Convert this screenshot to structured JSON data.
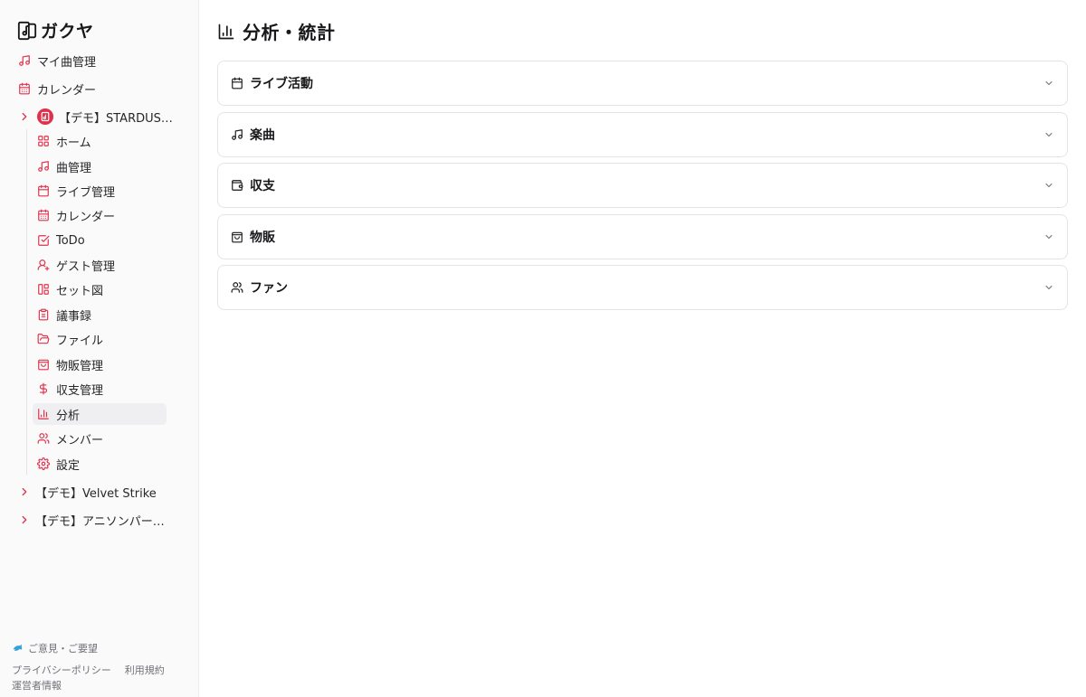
{
  "app": {
    "name": "ガクヤ"
  },
  "sidebar": {
    "top_items": [
      {
        "label": "マイ曲管理",
        "icon": "music-note-icon"
      },
      {
        "label": "カレンダー",
        "icon": "calendar-icon"
      }
    ],
    "bands": [
      {
        "label": "【デモ】STARDUS…",
        "expanded": true,
        "items": [
          {
            "label": "ホーム",
            "icon": "grid-icon"
          },
          {
            "label": "曲管理",
            "icon": "music-note-icon"
          },
          {
            "label": "ライブ管理",
            "icon": "calendar-icon"
          },
          {
            "label": "カレンダー",
            "icon": "calendar-days-icon"
          },
          {
            "label": "ToDo",
            "icon": "checkbox-icon"
          },
          {
            "label": "ゲスト管理",
            "icon": "user-plus-icon"
          },
          {
            "label": "セット図",
            "icon": "layout-icon"
          },
          {
            "label": "議事録",
            "icon": "clipboard-icon"
          },
          {
            "label": "ファイル",
            "icon": "folder-open-icon"
          },
          {
            "label": "物販管理",
            "icon": "shopping-bag-icon"
          },
          {
            "label": "収支管理",
            "icon": "dollar-icon"
          },
          {
            "label": "分析",
            "icon": "bar-chart-icon",
            "active": true
          },
          {
            "label": "メンバー",
            "icon": "users-icon"
          },
          {
            "label": "設定",
            "icon": "gear-icon"
          }
        ]
      },
      {
        "label": "【デモ】Velvet Strike",
        "expanded": false
      },
      {
        "label": "【デモ】アニソンパーテ…",
        "expanded": false
      }
    ],
    "footer": {
      "feedback": "ご意見・ご要望",
      "privacy": "プライバシーポリシー",
      "terms": "利用規約",
      "operator": "運営者情報"
    }
  },
  "main": {
    "title": "分析・統計",
    "sections": [
      {
        "label": "ライブ活動",
        "icon": "calendar-icon"
      },
      {
        "label": "楽曲",
        "icon": "music-note-icon"
      },
      {
        "label": "収支",
        "icon": "wallet-icon"
      },
      {
        "label": "物販",
        "icon": "shopping-bag-icon"
      },
      {
        "label": "ファン",
        "icon": "users-icon"
      }
    ]
  },
  "colors": {
    "accent": "#e0314b",
    "sidebar_bg": "#fafafa",
    "active_bg": "#efeff1",
    "border": "#e4e4e7"
  }
}
